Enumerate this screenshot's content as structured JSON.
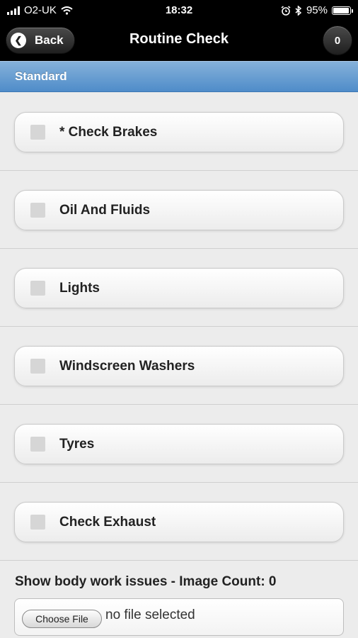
{
  "status_bar": {
    "carrier": "O2-UK",
    "time": "18:32",
    "battery_percent": "95%",
    "battery_level": 0.95
  },
  "header": {
    "back_label": "Back",
    "title": "Routine Check",
    "count": "0"
  },
  "section": {
    "title": "Standard"
  },
  "checks": [
    {
      "label": "* Check Brakes",
      "checked": false
    },
    {
      "label": "Oil And Fluids",
      "checked": false
    },
    {
      "label": "Lights",
      "checked": false
    },
    {
      "label": "Windscreen Washers",
      "checked": false
    },
    {
      "label": "Tyres",
      "checked": false
    },
    {
      "label": "Check Exhaust",
      "checked": false
    }
  ],
  "bodywork": {
    "label": "Show body work issues - Image Count: 0",
    "choose_file_label": "Choose File",
    "no_file_text": "no file selected"
  },
  "colors": {
    "header_bg": "#000000",
    "section_header": "#5b94cc"
  }
}
